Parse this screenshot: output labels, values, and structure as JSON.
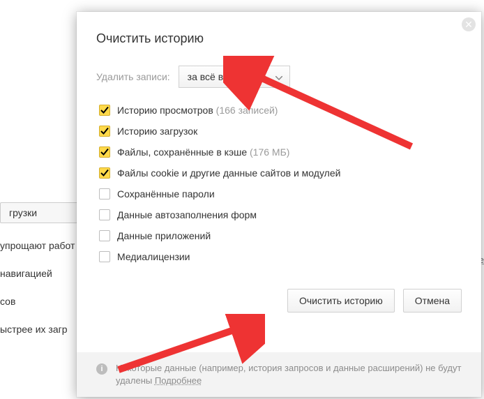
{
  "background": {
    "button": "грузки",
    "line1": "упрощают работ",
    "line2": "навигацией",
    "line3": "сов",
    "line4": "ыстрее их загр",
    "top_link": "ее"
  },
  "modal": {
    "title": "Очистить историю",
    "delete_label": "Удалить записи:",
    "select_value": "за всё время",
    "options": [
      {
        "label": "Историю просмотров",
        "extra": "(166 записей)",
        "checked": true
      },
      {
        "label": "Историю загрузок",
        "extra": "",
        "checked": true
      },
      {
        "label": "Файлы, сохранённые в кэше",
        "extra": "(176 МБ)",
        "checked": true
      },
      {
        "label": "Файлы cookie и другие данные сайтов и модулей",
        "extra": "",
        "checked": true
      },
      {
        "label": "Сохранённые пароли",
        "extra": "",
        "checked": false
      },
      {
        "label": "Данные автозаполнения форм",
        "extra": "",
        "checked": false
      },
      {
        "label": "Данные приложений",
        "extra": "",
        "checked": false
      },
      {
        "label": "Медиалицензии",
        "extra": "",
        "checked": false
      }
    ],
    "clear_btn": "Очистить историю",
    "cancel_btn": "Отмена",
    "footer_text": "Некоторые данные (например, история запросов и данные расширений) не будут удалены ",
    "footer_link": "Подробнее"
  }
}
